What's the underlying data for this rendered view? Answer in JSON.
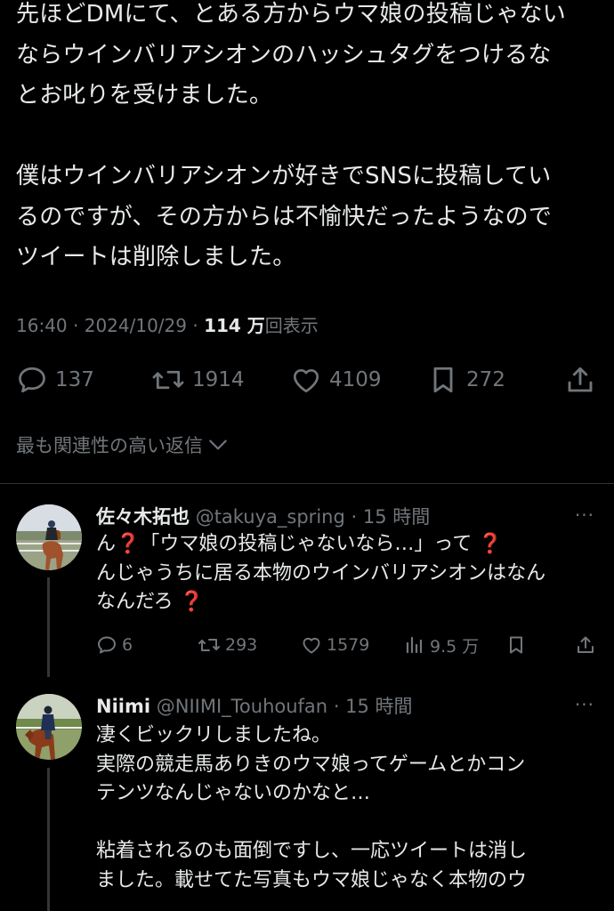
{
  "main_tweet": {
    "lines": [
      "先ほどDMにて、とある方からウマ娘の投稿じゃない",
      "ならウインバリアシオンのハッシュタグをつけるな",
      "とお叱りを受けました。",
      "",
      "僕はウインバリアシオンが好きでSNSに投稿してい",
      "るのですが、その方からは不愉快だったようなので",
      "ツイートは削除しました。"
    ],
    "time": "16:40",
    "date": "2024/10/29",
    "separator": "·",
    "views": "114 万",
    "views_label": "回表示",
    "actions": {
      "replies": "137",
      "reposts": "1914",
      "likes": "4109",
      "bookmarks": "272"
    },
    "icons": [
      "reply-icon",
      "repost-icon",
      "like-icon",
      "bookmark-icon",
      "share-icon"
    ]
  },
  "sort": {
    "label": "最も関連性の高い返信"
  },
  "replies": [
    {
      "name": "佐々木拓也",
      "handle": "@takuya_spring",
      "time": "· 15 時間",
      "more": "···",
      "line1_a": "ん",
      "line1_b": "「ウマ娘の投稿じゃないなら…」って",
      "line2": "んじゃうちに居る本物のウインバリアシオンはなん",
      "line3_a": "なんだろ",
      "question_mark": "❓",
      "actions": {
        "replies": "6",
        "reposts": "293",
        "likes": "1579",
        "views": "9.5 万"
      }
    },
    {
      "name": "Niimi",
      "handle": "@NIIMI_Touhoufan",
      "time": "· 15 時間",
      "more": "···",
      "lines": [
        "凄くビックリしましたね。",
        "実際の競走馬ありきのウマ娘ってゲームとかコン",
        "テンツなんじゃないのかなと…",
        "",
        "粘着されるのも面倒ですし、一応ツイートは消し",
        "ました。載せてた写真もウマ娘じゃなく本物のウ"
      ]
    }
  ],
  "colors": {
    "background": "#000000",
    "text": "#e7e9ea",
    "muted": "#71767b",
    "divider": "#2f3336",
    "emoji_red": "#e0245e"
  }
}
